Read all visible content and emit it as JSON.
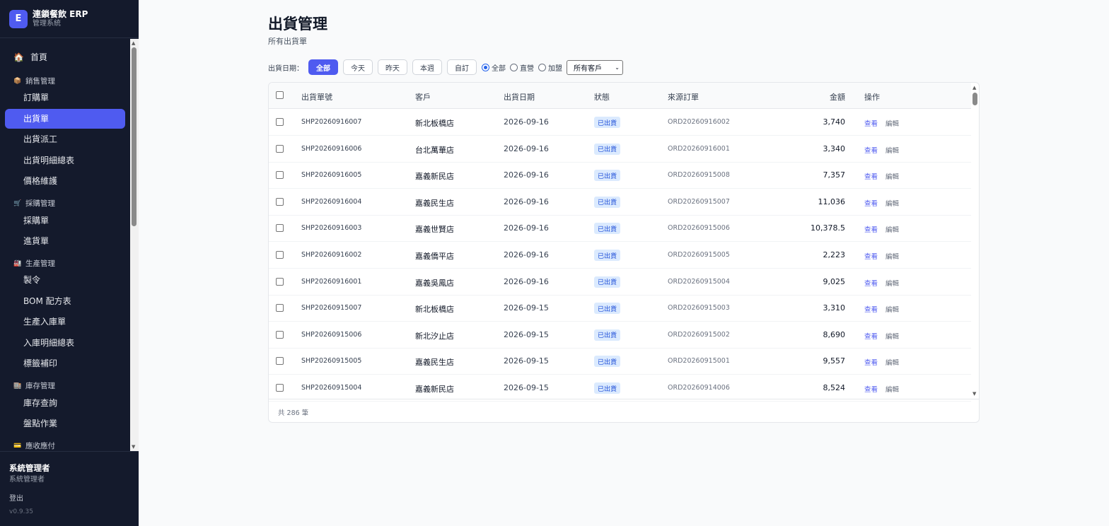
{
  "brand": {
    "logo_letter": "E",
    "title": "連鎖餐飲 ERP",
    "subtitle": "管理系統"
  },
  "nav": {
    "home": "首頁",
    "sales": {
      "title": "銷售管理",
      "items": [
        "訂購單",
        "出貨單",
        "出貨派工",
        "出貨明細總表",
        "價格維護"
      ]
    },
    "purchasing": {
      "title": "採購管理",
      "items": [
        "採購單",
        "進貨單"
      ]
    },
    "production": {
      "title": "生產管理",
      "items": [
        "製令",
        "BOM 配方表",
        "生產入庫單",
        "入庫明細總表",
        "標籤補印"
      ]
    },
    "inventory": {
      "title": "庫存管理",
      "items": [
        "庫存查詢",
        "盤點作業"
      ]
    },
    "finance": {
      "title": "應收應付"
    },
    "active_item": "出貨單"
  },
  "user": {
    "name": "系統管理者",
    "role": "系統管理者",
    "logout": "登出",
    "version": "v0.9.35"
  },
  "page": {
    "title": "出貨管理",
    "subtitle": "所有出貨單"
  },
  "filters": {
    "date_label": "出貨日期：",
    "date_chips": [
      "全部",
      "今天",
      "昨天",
      "本週",
      "自訂"
    ],
    "active_chip": "全部",
    "store_types": [
      "全部",
      "直營",
      "加盟"
    ],
    "selected_store_type": "全部",
    "customer_select": "所有客戶"
  },
  "table": {
    "columns": [
      "出貨單號",
      "客戶",
      "出貨日期",
      "狀態",
      "來源訂單",
      "金額",
      "操作"
    ],
    "rows": [
      {
        "shp": "SHP20260916007",
        "customer": "新北板橋店",
        "date": "2026-09-16",
        "status": "已出貨",
        "order": "ORD20260916002",
        "amount": "3,740"
      },
      {
        "shp": "SHP20260916006",
        "customer": "台北萬華店",
        "date": "2026-09-16",
        "status": "已出貨",
        "order": "ORD20260916001",
        "amount": "3,340"
      },
      {
        "shp": "SHP20260916005",
        "customer": "嘉義新民店",
        "date": "2026-09-16",
        "status": "已出貨",
        "order": "ORD20260915008",
        "amount": "7,357"
      },
      {
        "shp": "SHP20260916004",
        "customer": "嘉義民生店",
        "date": "2026-09-16",
        "status": "已出貨",
        "order": "ORD20260915007",
        "amount": "11,036"
      },
      {
        "shp": "SHP20260916003",
        "customer": "嘉義世賢店",
        "date": "2026-09-16",
        "status": "已出貨",
        "order": "ORD20260915006",
        "amount": "10,378.5"
      },
      {
        "shp": "SHP20260916002",
        "customer": "嘉義僑平店",
        "date": "2026-09-16",
        "status": "已出貨",
        "order": "ORD20260915005",
        "amount": "2,223"
      },
      {
        "shp": "SHP20260916001",
        "customer": "嘉義吳鳳店",
        "date": "2026-09-16",
        "status": "已出貨",
        "order": "ORD20260915004",
        "amount": "9,025"
      },
      {
        "shp": "SHP20260915007",
        "customer": "新北板橋店",
        "date": "2026-09-15",
        "status": "已出貨",
        "order": "ORD20260915003",
        "amount": "3,310"
      },
      {
        "shp": "SHP20260915006",
        "customer": "新北汐止店",
        "date": "2026-09-15",
        "status": "已出貨",
        "order": "ORD20260915002",
        "amount": "8,690"
      },
      {
        "shp": "SHP20260915005",
        "customer": "嘉義民生店",
        "date": "2026-09-15",
        "status": "已出貨",
        "order": "ORD20260915001",
        "amount": "9,557"
      },
      {
        "shp": "SHP20260915004",
        "customer": "嘉義新民店",
        "date": "2026-09-15",
        "status": "已出貨",
        "order": "ORD20260914006",
        "amount": "8,524"
      }
    ],
    "actions": {
      "view": "查看",
      "edit": "編輯"
    },
    "total": "共 286 筆"
  },
  "colors": {
    "sidebar_bg": "#141a2c",
    "accent": "#4f5bf0",
    "badge_bg": "#dbeafe",
    "badge_text": "#1d4ed8"
  }
}
